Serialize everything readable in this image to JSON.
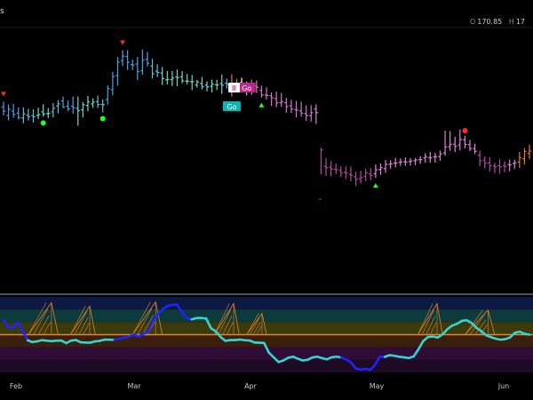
{
  "header": {
    "symbol_fragment": "s",
    "ohlc": [
      {
        "label": "O",
        "value": "170.85"
      },
      {
        "label": "H",
        "value": "17"
      }
    ]
  },
  "chart_data": {
    "type": "ohlc_with_indicator",
    "x_labels": [
      "Feb",
      "Mar",
      "Apr",
      "May",
      "Jun"
    ],
    "price_pane": {
      "bars": [
        {
          "o": 0.3,
          "h": 0.279,
          "l": 0.333,
          "c": 0.316,
          "color": "#47a3e3"
        },
        {
          "o": 0.333,
          "h": 0.29,
          "l": 0.352,
          "c": 0.309,
          "color": "#47a3e3"
        },
        {
          "o": 0.316,
          "h": 0.288,
          "l": 0.342,
          "c": 0.329,
          "color": "#47a3e3"
        },
        {
          "o": 0.324,
          "h": 0.301,
          "l": 0.349,
          "c": 0.341,
          "color": "#47a3e3"
        },
        {
          "o": 0.343,
          "h": 0.301,
          "l": 0.364,
          "c": 0.327,
          "color": "#5fbfd6"
        },
        {
          "o": 0.332,
          "h": 0.307,
          "l": 0.353,
          "c": 0.337,
          "color": "#5fbfd6"
        },
        {
          "o": 0.334,
          "h": 0.309,
          "l": 0.361,
          "c": 0.338,
          "color": "#5fbfd6"
        },
        {
          "o": 0.333,
          "h": 0.303,
          "l": 0.347,
          "c": 0.33,
          "color": "#6fd8c6"
        },
        {
          "o": 0.319,
          "h": 0.289,
          "l": 0.338,
          "c": 0.327,
          "color": "#6fd8c6"
        },
        {
          "o": 0.326,
          "h": 0.304,
          "l": 0.343,
          "c": 0.325,
          "color": "#6fd8c6"
        },
        {
          "o": 0.319,
          "h": 0.285,
          "l": 0.341,
          "c": 0.305,
          "color": "#5fbfd6"
        },
        {
          "o": 0.296,
          "h": 0.273,
          "l": 0.325,
          "c": 0.288,
          "color": "#5fbfd6"
        },
        {
          "o": 0.276,
          "h": 0.259,
          "l": 0.304,
          "c": 0.3,
          "color": "#47a3e3"
        },
        {
          "o": 0.297,
          "h": 0.275,
          "l": 0.316,
          "c": 0.307,
          "color": "#47a3e3"
        },
        {
          "o": 0.297,
          "h": 0.259,
          "l": 0.326,
          "c": 0.303,
          "color": "#47a3e3"
        },
        {
          "o": 0.305,
          "h": 0.259,
          "l": 0.373,
          "c": 0.314,
          "color": "#6fd8c6"
        },
        {
          "o": 0.311,
          "h": 0.281,
          "l": 0.341,
          "c": 0.291,
          "color": "#6fd8c6"
        },
        {
          "o": 0.294,
          "h": 0.257,
          "l": 0.316,
          "c": 0.28,
          "color": "#6fd8c6"
        },
        {
          "o": 0.288,
          "h": 0.266,
          "l": 0.303,
          "c": 0.281,
          "color": "#6fd8c6"
        },
        {
          "o": 0.279,
          "h": 0.255,
          "l": 0.304,
          "c": 0.29,
          "color": "#5fbfd6"
        },
        {
          "o": 0.29,
          "h": 0.27,
          "l": 0.321,
          "c": 0.291,
          "color": "#5fbfd6"
        },
        {
          "o": 0.271,
          "h": 0.216,
          "l": 0.291,
          "c": 0.228,
          "color": "#47a3e3"
        },
        {
          "o": 0.232,
          "h": 0.163,
          "l": 0.255,
          "c": 0.181,
          "color": "#47a3e3"
        },
        {
          "o": 0.177,
          "h": 0.105,
          "l": 0.217,
          "c": 0.125,
          "color": "#47a3e3"
        },
        {
          "o": 0.119,
          "h": 0.078,
          "l": 0.14,
          "c": 0.101,
          "color": "#47a3e3"
        },
        {
          "o": 0.103,
          "h": 0.078,
          "l": 0.155,
          "c": 0.125,
          "color": "#47a3e3"
        },
        {
          "o": 0.134,
          "h": 0.114,
          "l": 0.156,
          "c": 0.136,
          "color": "#47a3e3"
        },
        {
          "o": 0.132,
          "h": 0.104,
          "l": 0.195,
          "c": 0.161,
          "color": "#47a3e3"
        },
        {
          "o": 0.158,
          "h": 0.075,
          "l": 0.174,
          "c": 0.117,
          "color": "#47a3e3"
        },
        {
          "o": 0.114,
          "h": 0.085,
          "l": 0.142,
          "c": 0.129,
          "color": "#47a3e3"
        },
        {
          "o": 0.14,
          "h": 0.112,
          "l": 0.189,
          "c": 0.17,
          "color": "#5fbfd6"
        },
        {
          "o": 0.16,
          "h": 0.133,
          "l": 0.183,
          "c": 0.165,
          "color": "#5fbfd6"
        },
        {
          "o": 0.167,
          "h": 0.144,
          "l": 0.214,
          "c": 0.189,
          "color": "#6fd8c6"
        },
        {
          "o": 0.194,
          "h": 0.159,
          "l": 0.212,
          "c": 0.192,
          "color": "#6fd8c6"
        },
        {
          "o": 0.193,
          "h": 0.159,
          "l": 0.218,
          "c": 0.187,
          "color": "#6fd8c6"
        },
        {
          "o": 0.183,
          "h": 0.153,
          "l": 0.219,
          "c": 0.185,
          "color": "#6fd8c6"
        },
        {
          "o": 0.182,
          "h": 0.16,
          "l": 0.207,
          "c": 0.198,
          "color": "#6fd8c6"
        },
        {
          "o": 0.199,
          "h": 0.171,
          "l": 0.211,
          "c": 0.199,
          "color": "#6fd8c6"
        },
        {
          "o": 0.201,
          "h": 0.175,
          "l": 0.234,
          "c": 0.201,
          "color": "#6fd8c6"
        },
        {
          "o": 0.214,
          "h": 0.194,
          "l": 0.224,
          "c": 0.202,
          "color": "#6fd8c6"
        },
        {
          "o": 0.208,
          "h": 0.183,
          "l": 0.231,
          "c": 0.22,
          "color": "#6fd8c6"
        },
        {
          "o": 0.214,
          "h": 0.2,
          "l": 0.239,
          "c": 0.221,
          "color": "#6fd8c6"
        },
        {
          "o": 0.219,
          "h": 0.193,
          "l": 0.243,
          "c": 0.211,
          "color": "#6fd8c6"
        },
        {
          "o": 0.213,
          "h": 0.194,
          "l": 0.233,
          "c": 0.214,
          "color": "#6fd8c6"
        },
        {
          "o": 0.208,
          "h": 0.173,
          "l": 0.249,
          "c": 0.215,
          "color": "#6fd8c6"
        },
        {
          "o": 0.207,
          "h": 0.189,
          "l": 0.228,
          "c": 0.211,
          "color": "#5fbfd6"
        },
        {
          "o": 0.219,
          "h": 0.172,
          "l": 0.259,
          "c": 0.207,
          "color": "#e07a2e"
        },
        {
          "o": 0.222,
          "h": 0.19,
          "l": 0.244,
          "c": 0.209,
          "color": "#e07a2e"
        },
        {
          "o": 0.205,
          "h": 0.186,
          "l": 0.238,
          "c": 0.222,
          "color": "#ffffff"
        },
        {
          "o": 0.22,
          "h": 0.2,
          "l": 0.255,
          "c": 0.222,
          "color": "#c4c4c4"
        },
        {
          "o": 0.214,
          "h": 0.193,
          "l": 0.253,
          "c": 0.22,
          "color": "#cf77cf"
        },
        {
          "o": 0.218,
          "h": 0.196,
          "l": 0.245,
          "c": 0.223,
          "color": "#cf77cf"
        },
        {
          "o": 0.235,
          "h": 0.217,
          "l": 0.263,
          "c": 0.253,
          "color": "#cf77cf"
        },
        {
          "o": 0.253,
          "h": 0.223,
          "l": 0.271,
          "c": 0.255,
          "color": "#cf77cf"
        },
        {
          "o": 0.256,
          "h": 0.243,
          "l": 0.296,
          "c": 0.264,
          "color": "#cf77cf"
        },
        {
          "o": 0.267,
          "h": 0.24,
          "l": 0.301,
          "c": 0.284,
          "color": "#cf77cf"
        },
        {
          "o": 0.283,
          "h": 0.245,
          "l": 0.3,
          "c": 0.279,
          "color": "#cf77cf"
        },
        {
          "o": 0.283,
          "h": 0.264,
          "l": 0.322,
          "c": 0.298,
          "color": "#cf77cf"
        },
        {
          "o": 0.295,
          "h": 0.272,
          "l": 0.323,
          "c": 0.308,
          "color": "#cf77cf"
        },
        {
          "o": 0.31,
          "h": 0.276,
          "l": 0.341,
          "c": 0.312,
          "color": "#cf77cf"
        },
        {
          "o": 0.315,
          "h": 0.28,
          "l": 0.338,
          "c": 0.324,
          "color": "#cf77cf"
        },
        {
          "o": 0.326,
          "h": 0.293,
          "l": 0.354,
          "c": 0.333,
          "color": "#cf77cf"
        },
        {
          "o": 0.334,
          "h": 0.293,
          "l": 0.357,
          "c": 0.322,
          "color": "#cf77cf"
        },
        {
          "o": 0.308,
          "h": 0.29,
          "l": 0.366,
          "c": 0.322,
          "color": "#dd85d6"
        },
        {
          "o": 0.66,
          "h": 0.459,
          "l": 0.563,
          "c": 0.468,
          "color": "#b04aa3"
        },
        {
          "o": 0.532,
          "h": 0.499,
          "l": 0.569,
          "c": 0.537,
          "color": "#b04aa3"
        },
        {
          "o": 0.535,
          "h": 0.511,
          "l": 0.571,
          "c": 0.542,
          "color": "#b04aa3"
        },
        {
          "o": 0.543,
          "h": 0.52,
          "l": 0.562,
          "c": 0.545,
          "color": "#b04aa3"
        },
        {
          "o": 0.548,
          "h": 0.532,
          "l": 0.573,
          "c": 0.557,
          "color": "#b04aa3"
        },
        {
          "o": 0.555,
          "h": 0.532,
          "l": 0.581,
          "c": 0.558,
          "color": "#b04aa3"
        },
        {
          "o": 0.563,
          "h": 0.532,
          "l": 0.59,
          "c": 0.567,
          "color": "#b04aa3"
        },
        {
          "o": 0.573,
          "h": 0.553,
          "l": 0.608,
          "c": 0.582,
          "color": "#b04aa3"
        },
        {
          "o": 0.58,
          "h": 0.549,
          "l": 0.598,
          "c": 0.575,
          "color": "#b04aa3"
        },
        {
          "o": 0.57,
          "h": 0.54,
          "l": 0.59,
          "c": 0.557,
          "color": "#b04aa3"
        },
        {
          "o": 0.562,
          "h": 0.538,
          "l": 0.586,
          "c": 0.567,
          "color": "#b04aa3"
        },
        {
          "o": 0.56,
          "h": 0.525,
          "l": 0.577,
          "c": 0.545,
          "color": "#dd85d6"
        },
        {
          "o": 0.544,
          "h": 0.52,
          "l": 0.565,
          "c": 0.537,
          "color": "#dd85d6"
        },
        {
          "o": 0.541,
          "h": 0.507,
          "l": 0.557,
          "c": 0.524,
          "color": "#dd85d6"
        },
        {
          "o": 0.524,
          "h": 0.508,
          "l": 0.541,
          "c": 0.522,
          "color": "#dd85d6"
        },
        {
          "o": 0.519,
          "h": 0.499,
          "l": 0.536,
          "c": 0.52,
          "color": "#dd85d6"
        },
        {
          "o": 0.516,
          "h": 0.501,
          "l": 0.53,
          "c": 0.514,
          "color": "#dd85d6"
        },
        {
          "o": 0.514,
          "h": 0.497,
          "l": 0.53,
          "c": 0.515,
          "color": "#dd85d6"
        },
        {
          "o": 0.513,
          "h": 0.5,
          "l": 0.529,
          "c": 0.511,
          "color": "#dd85d6"
        },
        {
          "o": 0.51,
          "h": 0.499,
          "l": 0.527,
          "c": 0.507,
          "color": "#dd85d6"
        },
        {
          "o": 0.506,
          "h": 0.492,
          "l": 0.522,
          "c": 0.506,
          "color": "#dd85d6"
        },
        {
          "o": 0.499,
          "h": 0.48,
          "l": 0.518,
          "c": 0.494,
          "color": "#dd85d6"
        },
        {
          "o": 0.498,
          "h": 0.475,
          "l": 0.518,
          "c": 0.498,
          "color": "#dd85d6"
        },
        {
          "o": 0.494,
          "h": 0.479,
          "l": 0.517,
          "c": 0.494,
          "color": "#dd85d6"
        },
        {
          "o": 0.494,
          "h": 0.47,
          "l": 0.51,
          "c": 0.483,
          "color": "#dd85d6"
        },
        {
          "o": 0.479,
          "h": 0.392,
          "l": 0.49,
          "c": 0.456,
          "color": "#dd85d6"
        },
        {
          "o": 0.455,
          "h": 0.394,
          "l": 0.471,
          "c": 0.446,
          "color": "#dd85d6"
        },
        {
          "o": 0.445,
          "h": 0.416,
          "l": 0.476,
          "c": 0.453,
          "color": "#dd85d6"
        },
        {
          "o": 0.448,
          "h": 0.388,
          "l": 0.469,
          "c": 0.427,
          "color": "#dd85d6"
        },
        {
          "o": 0.428,
          "h": 0.413,
          "l": 0.461,
          "c": 0.446,
          "color": "#dd85d6"
        },
        {
          "o": 0.447,
          "h": 0.428,
          "l": 0.472,
          "c": 0.462,
          "color": "#dd85d6"
        },
        {
          "o": 0.462,
          "h": 0.443,
          "l": 0.484,
          "c": 0.473,
          "color": "#dd85d6"
        },
        {
          "o": 0.488,
          "h": 0.47,
          "l": 0.531,
          "c": 0.511,
          "color": "#b04aa3"
        },
        {
          "o": 0.508,
          "h": 0.493,
          "l": 0.54,
          "c": 0.519,
          "color": "#b04aa3"
        },
        {
          "o": 0.519,
          "h": 0.496,
          "l": 0.552,
          "c": 0.529,
          "color": "#b04aa3"
        },
        {
          "o": 0.53,
          "h": 0.518,
          "l": 0.559,
          "c": 0.534,
          "color": "#b04aa3"
        },
        {
          "o": 0.529,
          "h": 0.504,
          "l": 0.561,
          "c": 0.534,
          "color": "#b04aa3"
        },
        {
          "o": 0.529,
          "h": 0.512,
          "l": 0.555,
          "c": 0.532,
          "color": "#b04aa3"
        },
        {
          "o": 0.525,
          "h": 0.505,
          "l": 0.551,
          "c": 0.526,
          "color": "#dd85d6"
        },
        {
          "o": 0.52,
          "h": 0.506,
          "l": 0.541,
          "c": 0.518,
          "color": "#dd85d6"
        },
        {
          "o": 0.515,
          "h": 0.476,
          "l": 0.538,
          "c": 0.498,
          "color": "#e07a2e"
        },
        {
          "o": 0.502,
          "h": 0.461,
          "l": 0.524,
          "c": 0.474,
          "color": "#e07a2e"
        },
        {
          "o": 0.481,
          "h": 0.447,
          "l": 0.503,
          "c": 0.472,
          "color": "#e07a2e"
        }
      ],
      "markers": [
        {
          "bar": 0,
          "kind": "triangle-down",
          "color": "#ff2a2a"
        },
        {
          "bar": 8,
          "kind": "dot",
          "color": "#22ff22"
        },
        {
          "bar": 20,
          "kind": "dot",
          "color": "#22ff22"
        },
        {
          "bar": 24,
          "kind": "triangle-down",
          "color": "#ff2a2a"
        },
        {
          "bar": 52,
          "kind": "triangle-up",
          "color": "#22ff22"
        },
        {
          "bar": 75,
          "kind": "triangle-up",
          "color": "#22ff22"
        },
        {
          "bar": 93,
          "kind": "dot",
          "color": "#ff2a2a"
        }
      ],
      "labels": [
        {
          "bar": 46,
          "text": "Go",
          "bg": "#11b2b2",
          "color": "#ffffff"
        },
        {
          "bar": 49,
          "text": "Go",
          "bg": "#b9268c",
          "color": "#ffffff"
        },
        {
          "bar": 47,
          "text": "Ⅲ",
          "bg": "#ffffff",
          "color": "#b9268c"
        }
      ]
    },
    "indicator_pane": {
      "zero_line": 0.462,
      "line": [
        0.286,
        0.376,
        0.371,
        0.312,
        0.419,
        0.531,
        0.553,
        0.543,
        0.529,
        0.536,
        0.541,
        0.535,
        0.535,
        0.565,
        0.535,
        0.528,
        0.555,
        0.559,
        0.559,
        0.544,
        0.537,
        0.522,
        0.524,
        0.524,
        0.509,
        0.499,
        0.486,
        0.462,
        0.486,
        0.45,
        0.421,
        0.29,
        0.217,
        0.149,
        0.11,
        0.096,
        0.096,
        0.188,
        0.259,
        0.275,
        0.259,
        0.258,
        0.265,
        0.384,
        0.421,
        0.491,
        0.538,
        0.528,
        0.528,
        0.522,
        0.53,
        0.533,
        0.558,
        0.56,
        0.563,
        0.682,
        0.74,
        0.797,
        0.777,
        0.744,
        0.731,
        0.756,
        0.777,
        0.77,
        0.741,
        0.731,
        0.749,
        0.764,
        0.739,
        0.731,
        0.741,
        0.766,
        0.799,
        0.875,
        0.889,
        0.879,
        0.893,
        0.83,
        0.728,
        0.734,
        0.712,
        0.72,
        0.732,
        0.739,
        0.748,
        0.728,
        0.64,
        0.539,
        0.49,
        0.485,
        0.497,
        0.458,
        0.395,
        0.351,
        0.329,
        0.293,
        0.286,
        0.319,
        0.377,
        0.418,
        0.469,
        0.492,
        0.511,
        0.523,
        0.517,
        0.495,
        0.438,
        0.426,
        0.452,
        0.462
      ],
      "line_color_pos": "#36d3d3",
      "line_color_neg": "#2222ff",
      "bands": [
        {
          "from": 0.0,
          "to": 0.154,
          "color": "#0c1a43"
        },
        {
          "from": 0.154,
          "to": 0.308,
          "color": "#0d3a3a"
        },
        {
          "from": 0.308,
          "to": 0.462,
          "color": "#3a3a0c"
        },
        {
          "from": 0.462,
          "to": 0.615,
          "color": "#3a1f0c"
        },
        {
          "from": 0.615,
          "to": 0.769,
          "color": "#2f0c35"
        },
        {
          "from": 0.769,
          "to": 0.923,
          "color": "#1e0a24"
        }
      ],
      "spikes": [
        {
          "bar": 8,
          "height": 0.39,
          "width_bars": 6
        },
        {
          "bar": 16,
          "height": 0.35,
          "width_bars": 5
        },
        {
          "bar": 29,
          "height": 0.4,
          "width_bars": 6
        },
        {
          "bar": 45,
          "height": 0.38,
          "width_bars": 5
        },
        {
          "bar": 51,
          "height": 0.26,
          "width_bars": 4
        },
        {
          "bar": 86,
          "height": 0.38,
          "width_bars": 5
        },
        {
          "bar": 96,
          "height": 0.3,
          "width_bars": 6
        }
      ]
    }
  }
}
